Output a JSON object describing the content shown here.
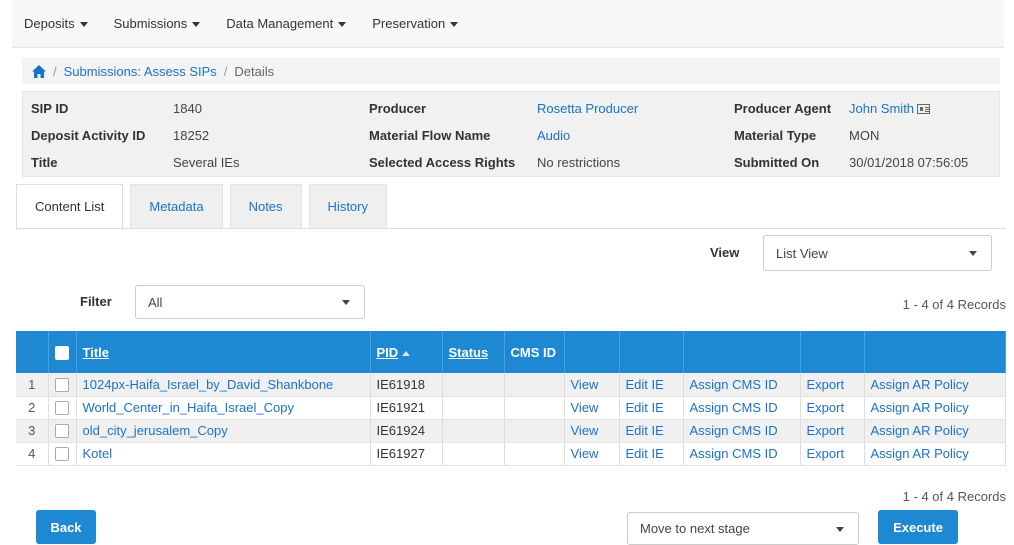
{
  "nav": {
    "items": [
      "Deposits",
      "Submissions",
      "Data Management",
      "Preservation"
    ]
  },
  "breadcrumb": {
    "home_icon": "home-icon",
    "parent": "Submissions: Assess SIPs",
    "current": "Details"
  },
  "details": {
    "sip_id_label": "SIP ID",
    "sip_id": "1840",
    "deposit_activity_label": "Deposit Activity ID",
    "deposit_activity": "18252",
    "title_label": "Title",
    "title": "Several IEs",
    "producer_label": "Producer",
    "producer": "Rosetta Producer",
    "material_flow_label": "Material Flow Name",
    "material_flow": "Audio",
    "access_rights_label": "Selected Access Rights",
    "access_rights": "No restrictions",
    "producer_agent_label": "Producer Agent",
    "producer_agent": "John Smith",
    "material_type_label": "Material Type",
    "material_type": "MON",
    "submitted_on_label": "Submitted On",
    "submitted_on": "30/01/2018 07:56:05"
  },
  "tabs": [
    "Content List",
    "Metadata",
    "Notes",
    "History"
  ],
  "view": {
    "label": "View",
    "value": "List View"
  },
  "filter": {
    "label": "Filter",
    "value": "All"
  },
  "records_top": "1 - 4 of 4 Records",
  "records_bottom": "1 - 4 of 4 Records",
  "table": {
    "headers": {
      "title": "Title",
      "pid": "PID",
      "status": "Status",
      "cms_id": "CMS ID"
    },
    "rows": [
      {
        "num": "1",
        "title": "1024px-Haifa_Israel_by_David_Shankbone",
        "pid": "IE61918",
        "status": "",
        "cms": "",
        "view": "View",
        "edit": "Edit IE",
        "assign_cms": "Assign CMS ID",
        "export": "Export",
        "assign_ar": "Assign AR Policy"
      },
      {
        "num": "2",
        "title": "World_Center_in_Haifa_Israel_Copy",
        "pid": "IE61921",
        "status": "",
        "cms": "",
        "view": "View",
        "edit": "Edit IE",
        "assign_cms": "Assign CMS ID",
        "export": "Export",
        "assign_ar": "Assign AR Policy"
      },
      {
        "num": "3",
        "title": "old_city_jerusalem_Copy",
        "pid": "IE61924",
        "status": "",
        "cms": "",
        "view": "View",
        "edit": "Edit IE",
        "assign_cms": "Assign CMS ID",
        "export": "Export",
        "assign_ar": "Assign AR Policy"
      },
      {
        "num": "4",
        "title": "Kotel",
        "pid": "IE61927",
        "status": "",
        "cms": "",
        "view": "View",
        "edit": "Edit IE",
        "assign_cms": "Assign CMS ID",
        "export": "Export",
        "assign_ar": "Assign AR Policy"
      }
    ]
  },
  "footer": {
    "back_label": "Back",
    "stage_select": "Move to next stage",
    "execute_label": "Execute"
  },
  "colors": {
    "accent": "#1e88d3",
    "link": "#1a73c7"
  }
}
